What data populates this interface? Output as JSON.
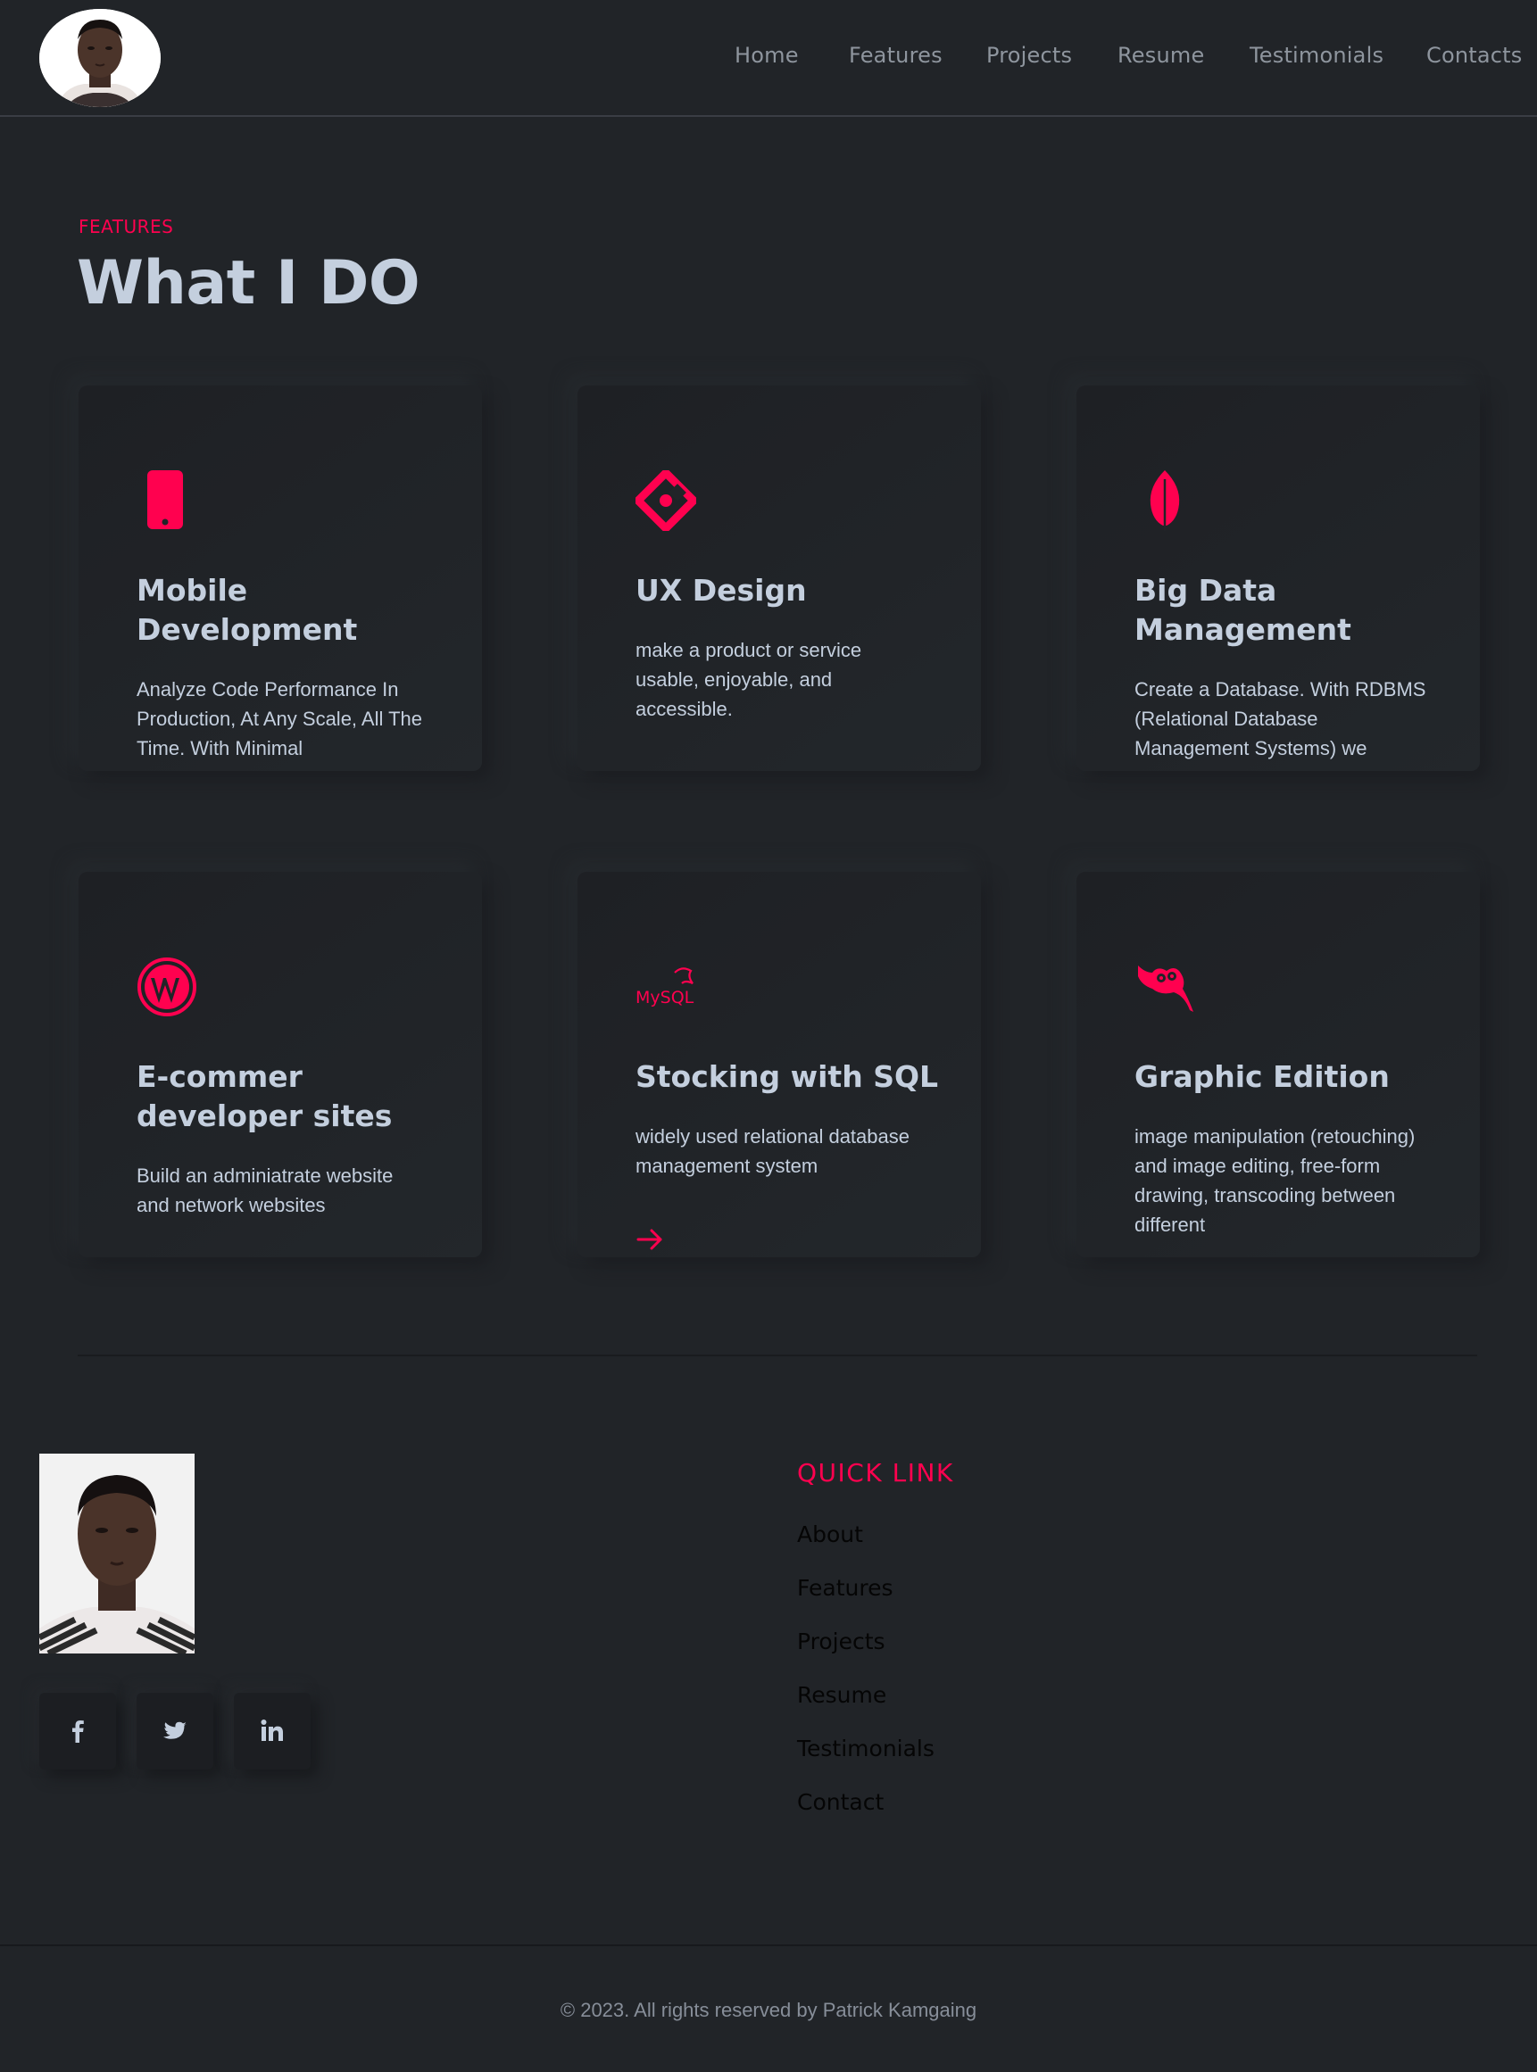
{
  "header": {
    "nav": [
      "Home",
      "Features",
      "Projects",
      "Resume",
      "Testimonials",
      "Contacts"
    ]
  },
  "features": {
    "eyebrow": "FEATURES",
    "title": "What I DO",
    "cards": [
      {
        "icon": "mobile-phone-icon",
        "title": "Mobile Development",
        "title_lines": [
          "Mobile",
          "Development"
        ],
        "text": "Analyze Code Performance In Production, At Any Scale, All The Time. With Minimal"
      },
      {
        "icon": "ux-diamond-icon",
        "title": "UX Design",
        "text": "make a product or service usable, enjoyable, and accessible."
      },
      {
        "icon": "leaf-icon",
        "title": "Big Data Management",
        "title_lines": [
          "Big Data",
          "Management"
        ],
        "text": "Create a Database. With RDBMS (Relational Database Management Systems) we"
      },
      {
        "icon": "wordpress-icon",
        "title": "E-commer developer sites",
        "title_lines": [
          "E-commer",
          "developer sites"
        ],
        "text": "Build an adminiatrate website and network websites"
      },
      {
        "icon": "mysql-icon",
        "title": "Stocking with SQL",
        "text": "widely used relational database management system",
        "logo_text": "MySQL"
      },
      {
        "icon": "gimp-icon",
        "title": "Graphic Edition",
        "text": "image manipulation (retouching) and image editing, free-form drawing, transcoding between different"
      }
    ]
  },
  "footer": {
    "quick_link_title": "QUICK LINK",
    "quick_links": [
      "About",
      "Features",
      "Projects",
      "Resume",
      "Testimonials",
      "Contact"
    ],
    "socials": [
      "facebook-icon",
      "twitter-icon",
      "linkedin-icon"
    ],
    "copyright": "© 2023. All rights reserved by Patrick Kamgaing"
  },
  "colors": {
    "accent": "#ff014f",
    "background": "#212428",
    "text": "#c4cfde"
  }
}
